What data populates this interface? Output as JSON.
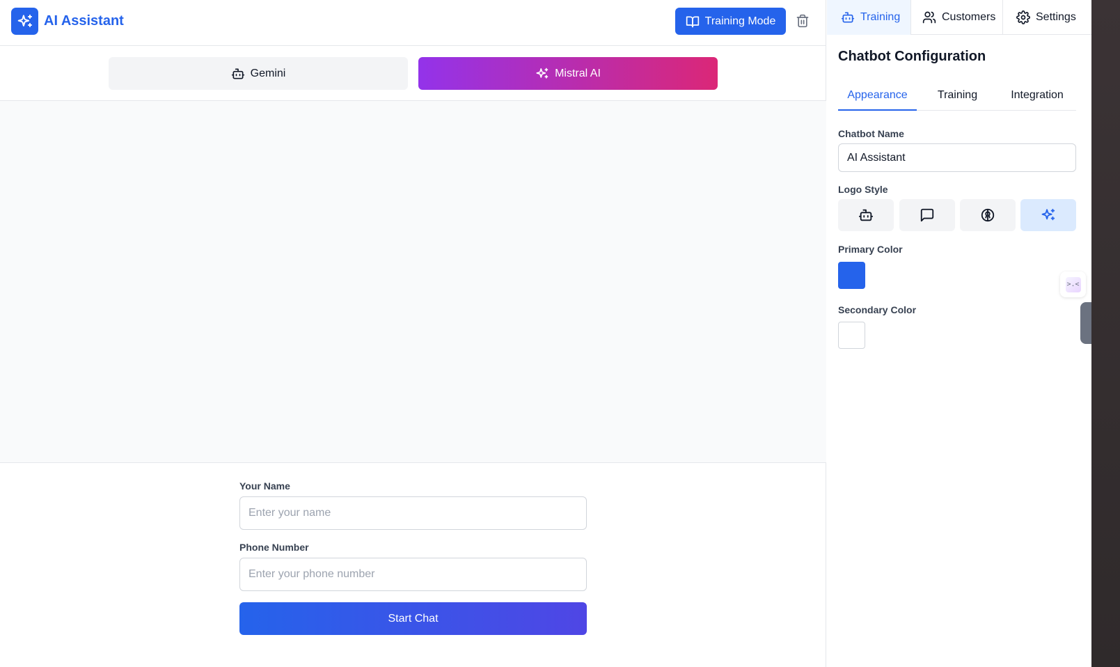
{
  "header": {
    "app_title": "AI Assistant",
    "training_mode_label": "Training Mode"
  },
  "models": {
    "gemini_label": "Gemini",
    "mistral_label": "Mistral AI",
    "active": "Mistral AI"
  },
  "form": {
    "name_label": "Your Name",
    "name_placeholder": "Enter your name",
    "phone_label": "Phone Number",
    "phone_placeholder": "Enter your phone number",
    "start_label": "Start Chat"
  },
  "sidebar": {
    "top_tabs": [
      {
        "label": "Training",
        "icon": "bot-icon",
        "active": true
      },
      {
        "label": "Customers",
        "icon": "users-icon",
        "active": false
      },
      {
        "label": "Settings",
        "icon": "gear-icon",
        "active": false
      }
    ],
    "title": "Chatbot Configuration",
    "sub_tabs": [
      {
        "label": "Appearance",
        "active": true
      },
      {
        "label": "Training",
        "active": false
      },
      {
        "label": "Integration",
        "active": false
      }
    ],
    "chatbot_name_label": "Chatbot Name",
    "chatbot_name_value": "AI Assistant",
    "logo_style_label": "Logo Style",
    "logo_options": [
      "bot-icon",
      "message-square-icon",
      "brain-icon",
      "sparkles-icon"
    ],
    "logo_selected": "sparkles-icon",
    "primary_color_label": "Primary Color",
    "primary_color": "#2563eb",
    "secondary_color_label": "Secondary Color",
    "secondary_color": "#ffffff"
  },
  "floating": {
    "glyph": ">.<"
  },
  "colors": {
    "accent": "#2563eb",
    "mistral_gradient_start": "#9333ea",
    "mistral_gradient_end": "#db2777"
  }
}
